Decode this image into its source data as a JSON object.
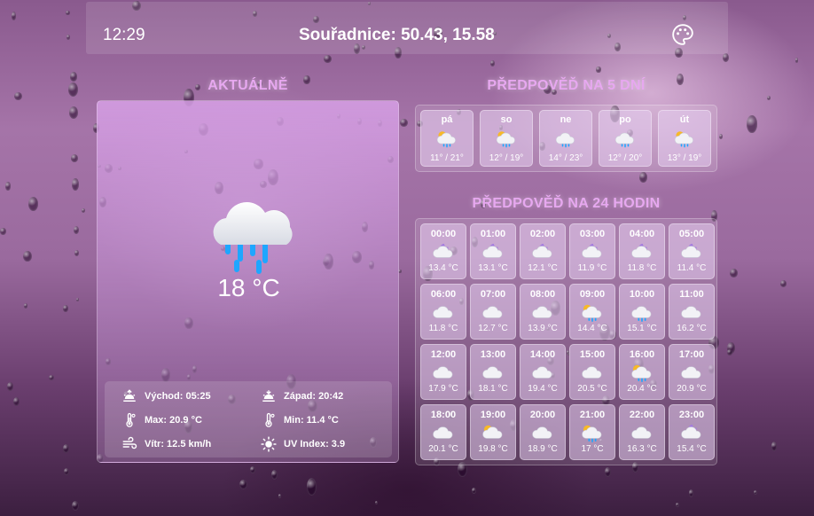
{
  "topbar": {
    "time": "12:29",
    "coordinates": "Souřadnice: 50.43, 15.58",
    "theme_icon": "palette-icon"
  },
  "current": {
    "title": "AKTUÁLNĚ",
    "icon": "cloud-rain-icon",
    "temperature": "18 °C",
    "details": {
      "sunrise": "Východ: 05:25",
      "sunset": "Západ: 20:42",
      "max": "Max: 20.9 °C",
      "min": "Min: 11.4 °C",
      "wind": "Vítr:  12.5 km/h",
      "uv": "UV Index: 3.9"
    }
  },
  "daily": {
    "title": "PŘEDPOVĚĎ NA 5 DNÍ",
    "days": [
      {
        "day": "pá",
        "icon": "sun-cloud-rain-icon",
        "temps": "11° / 21°"
      },
      {
        "day": "so",
        "icon": "sun-cloud-rain-icon",
        "temps": "12° / 19°"
      },
      {
        "day": "ne",
        "icon": "cloud-rain-icon",
        "temps": "14° / 23°"
      },
      {
        "day": "po",
        "icon": "cloud-rain-icon",
        "temps": "12° / 20°"
      },
      {
        "day": "út",
        "icon": "sun-cloud-rain-icon",
        "temps": "13° / 19°"
      }
    ]
  },
  "hourly": {
    "title": "PŘEDPOVĚĎ NA 24 HODIN",
    "hours": [
      {
        "time": "00:00",
        "icon": "moon-cloud-icon",
        "temp": "13.4 °C"
      },
      {
        "time": "01:00",
        "icon": "moon-cloud-icon",
        "temp": "13.1 °C"
      },
      {
        "time": "02:00",
        "icon": "moon-cloud-icon",
        "temp": "12.1 °C"
      },
      {
        "time": "03:00",
        "icon": "moon-cloud-icon",
        "temp": "11.9 °C"
      },
      {
        "time": "04:00",
        "icon": "moon-cloud-icon",
        "temp": "11.8 °C"
      },
      {
        "time": "05:00",
        "icon": "moon-cloud-icon",
        "temp": "11.4 °C"
      },
      {
        "time": "06:00",
        "icon": "cloud-icon",
        "temp": "11.8 °C"
      },
      {
        "time": "07:00",
        "icon": "cloud-icon",
        "temp": "12.7 °C"
      },
      {
        "time": "08:00",
        "icon": "cloud-icon",
        "temp": "13.9 °C"
      },
      {
        "time": "09:00",
        "icon": "sun-cloud-rain-icon",
        "temp": "14.4 °C"
      },
      {
        "time": "10:00",
        "icon": "cloud-rain-icon",
        "temp": "15.1 °C"
      },
      {
        "time": "11:00",
        "icon": "cloud-icon",
        "temp": "16.2 °C"
      },
      {
        "time": "12:00",
        "icon": "cloud-icon",
        "temp": "17.9 °C"
      },
      {
        "time": "13:00",
        "icon": "cloud-icon",
        "temp": "18.1 °C"
      },
      {
        "time": "14:00",
        "icon": "cloud-icon",
        "temp": "19.4 °C"
      },
      {
        "time": "15:00",
        "icon": "cloud-icon",
        "temp": "20.5 °C"
      },
      {
        "time": "16:00",
        "icon": "sun-cloud-rain-icon",
        "temp": "20.4 °C"
      },
      {
        "time": "17:00",
        "icon": "cloud-icon",
        "temp": "20.9 °C"
      },
      {
        "time": "18:00",
        "icon": "cloud-icon",
        "temp": "20.1 °C"
      },
      {
        "time": "19:00",
        "icon": "sun-cloud-icon",
        "temp": "19.8 °C"
      },
      {
        "time": "20:00",
        "icon": "cloud-icon",
        "temp": "18.9 °C"
      },
      {
        "time": "21:00",
        "icon": "sun-cloud-rain-icon",
        "temp": "17 °C"
      },
      {
        "time": "22:00",
        "icon": "cloud-icon",
        "temp": "16.3 °C"
      },
      {
        "time": "23:00",
        "icon": "moon-cloud-icon",
        "temp": "15.4 °C"
      }
    ]
  },
  "colors": {
    "accent": "#e7a8f0",
    "rain": "#1ea6ff",
    "sun": "#f7b928",
    "moon": "#a57be0"
  }
}
